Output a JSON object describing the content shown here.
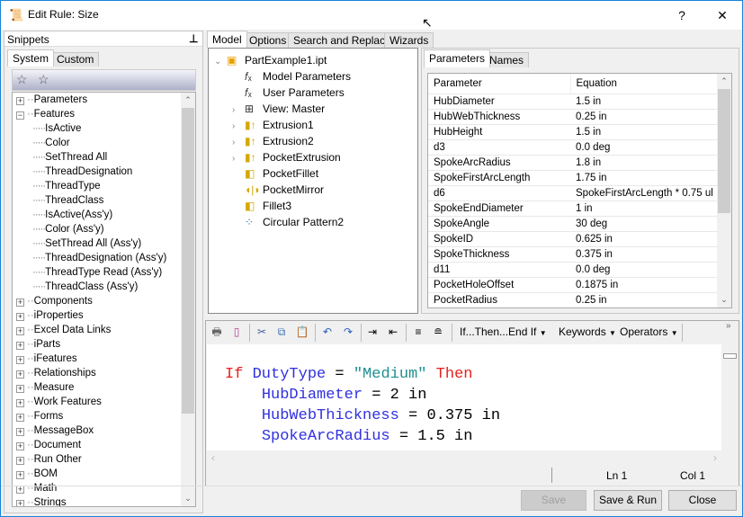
{
  "window": {
    "title": "Edit Rule: Size",
    "help": "?",
    "close": "✕"
  },
  "snippets": {
    "header": "Snippets",
    "tabs": [
      "System",
      "Custom"
    ],
    "tree": [
      {
        "label": "Parameters",
        "level": 0,
        "state": "+"
      },
      {
        "label": "Features",
        "level": 0,
        "state": "-"
      },
      {
        "label": "IsActive",
        "level": 1
      },
      {
        "label": "Color",
        "level": 1
      },
      {
        "label": "SetThread All",
        "level": 1
      },
      {
        "label": "ThreadDesignation",
        "level": 1
      },
      {
        "label": "ThreadType",
        "level": 1
      },
      {
        "label": "ThreadClass",
        "level": 1
      },
      {
        "label": "IsActive(Ass'y)",
        "level": 1
      },
      {
        "label": "Color (Ass'y)",
        "level": 1
      },
      {
        "label": "SetThread All (Ass'y)",
        "level": 1
      },
      {
        "label": "ThreadDesignation (Ass'y)",
        "level": 1
      },
      {
        "label": "ThreadType Read (Ass'y)",
        "level": 1
      },
      {
        "label": "ThreadClass (Ass'y)",
        "level": 1
      },
      {
        "label": "Components",
        "level": 0,
        "state": "+"
      },
      {
        "label": "iProperties",
        "level": 0,
        "state": "+"
      },
      {
        "label": "Excel Data Links",
        "level": 0,
        "state": "+"
      },
      {
        "label": "iParts",
        "level": 0,
        "state": "+"
      },
      {
        "label": "iFeatures",
        "level": 0,
        "state": "+"
      },
      {
        "label": "Relationships",
        "level": 0,
        "state": "+"
      },
      {
        "label": "Measure",
        "level": 0,
        "state": "+"
      },
      {
        "label": "Work Features",
        "level": 0,
        "state": "+"
      },
      {
        "label": "Forms",
        "level": 0,
        "state": "+"
      },
      {
        "label": "MessageBox",
        "level": 0,
        "state": "+"
      },
      {
        "label": "Document",
        "level": 0,
        "state": "+"
      },
      {
        "label": "Run Other",
        "level": 0,
        "state": "+"
      },
      {
        "label": "BOM",
        "level": 0,
        "state": "+"
      },
      {
        "label": "Math",
        "level": 0,
        "state": "+"
      },
      {
        "label": "Strings",
        "level": 0,
        "state": "+"
      }
    ]
  },
  "model": {
    "tabs": [
      "Model",
      "Options",
      "Search and Replace",
      "Wizards"
    ],
    "tree": [
      {
        "label": "PartExample1.ipt",
        "icon": "part-icon",
        "expander": "v",
        "indent": 0
      },
      {
        "label": "Model Parameters",
        "icon": "fx-icon",
        "indent": 1
      },
      {
        "label": "User Parameters",
        "icon": "fx-icon",
        "indent": 1
      },
      {
        "label": "View: Master",
        "icon": "view-icon",
        "expander": ">",
        "indent": 1
      },
      {
        "label": "Extrusion1",
        "icon": "extrusion-icon",
        "expander": ">",
        "indent": 1
      },
      {
        "label": "Extrusion2",
        "icon": "extrusion-icon",
        "expander": ">",
        "indent": 1
      },
      {
        "label": "PocketExtrusion",
        "icon": "extrusion-icon",
        "expander": ">",
        "indent": 1
      },
      {
        "label": "PocketFillet",
        "icon": "fillet-icon",
        "indent": 1
      },
      {
        "label": "PocketMirror",
        "icon": "mirror-icon",
        "indent": 1
      },
      {
        "label": "Fillet3",
        "icon": "fillet-icon",
        "indent": 1
      },
      {
        "label": "Circular Pattern2",
        "icon": "pattern-icon",
        "indent": 1
      }
    ]
  },
  "params": {
    "tabs": [
      "Parameters",
      "Names"
    ],
    "columns": [
      "Parameter",
      "Equation"
    ],
    "rows": [
      [
        "HubDiameter",
        "1.5 in"
      ],
      [
        "HubWebThickness",
        "0.25 in"
      ],
      [
        "HubHeight",
        "1.5 in"
      ],
      [
        "d3",
        "0.0 deg"
      ],
      [
        "SpokeArcRadius",
        "1.8 in"
      ],
      [
        "SpokeFirstArcLength",
        "1.75 in"
      ],
      [
        "d6",
        "SpokeFirstArcLength * 0.75 ul"
      ],
      [
        "SpokeEndDiameter",
        "1 in"
      ],
      [
        "SpokeAngle",
        "30 deg"
      ],
      [
        "SpokeID",
        "0.625 in"
      ],
      [
        "SpokeThickness",
        "0.375 in"
      ],
      [
        "d11",
        "0.0 deg"
      ],
      [
        "PocketHoleOffset",
        "0.1875 in"
      ],
      [
        "PocketRadius",
        "0.25 in"
      ]
    ]
  },
  "editor": {
    "toolbar": {
      "if_then": "If...Then...End If",
      "keywords": "Keywords",
      "operators": "Operators",
      "overflow": "»"
    },
    "code": [
      [
        {
          "t": "If ",
          "c": "kw"
        },
        {
          "t": "DutyType",
          "c": "id"
        },
        {
          "t": " = ",
          "c": ""
        },
        {
          "t": "\"Medium\"",
          "c": "str"
        },
        {
          "t": " Then",
          "c": "kw"
        }
      ],
      [
        {
          "t": "    ",
          "c": ""
        },
        {
          "t": "HubDiameter",
          "c": "id"
        },
        {
          "t": " = 2 in",
          "c": ""
        }
      ],
      [
        {
          "t": "    ",
          "c": ""
        },
        {
          "t": "HubWebThickness",
          "c": "id"
        },
        {
          "t": " = 0.375 in",
          "c": ""
        }
      ],
      [
        {
          "t": "    ",
          "c": ""
        },
        {
          "t": "SpokeArcRadius",
          "c": "id"
        },
        {
          "t": " = 1.5 in",
          "c": ""
        }
      ]
    ],
    "status": {
      "ln": "Ln 1",
      "col": "Col 1"
    }
  },
  "buttons": {
    "save": "Save",
    "save_run": "Save & Run",
    "close": "Close"
  }
}
